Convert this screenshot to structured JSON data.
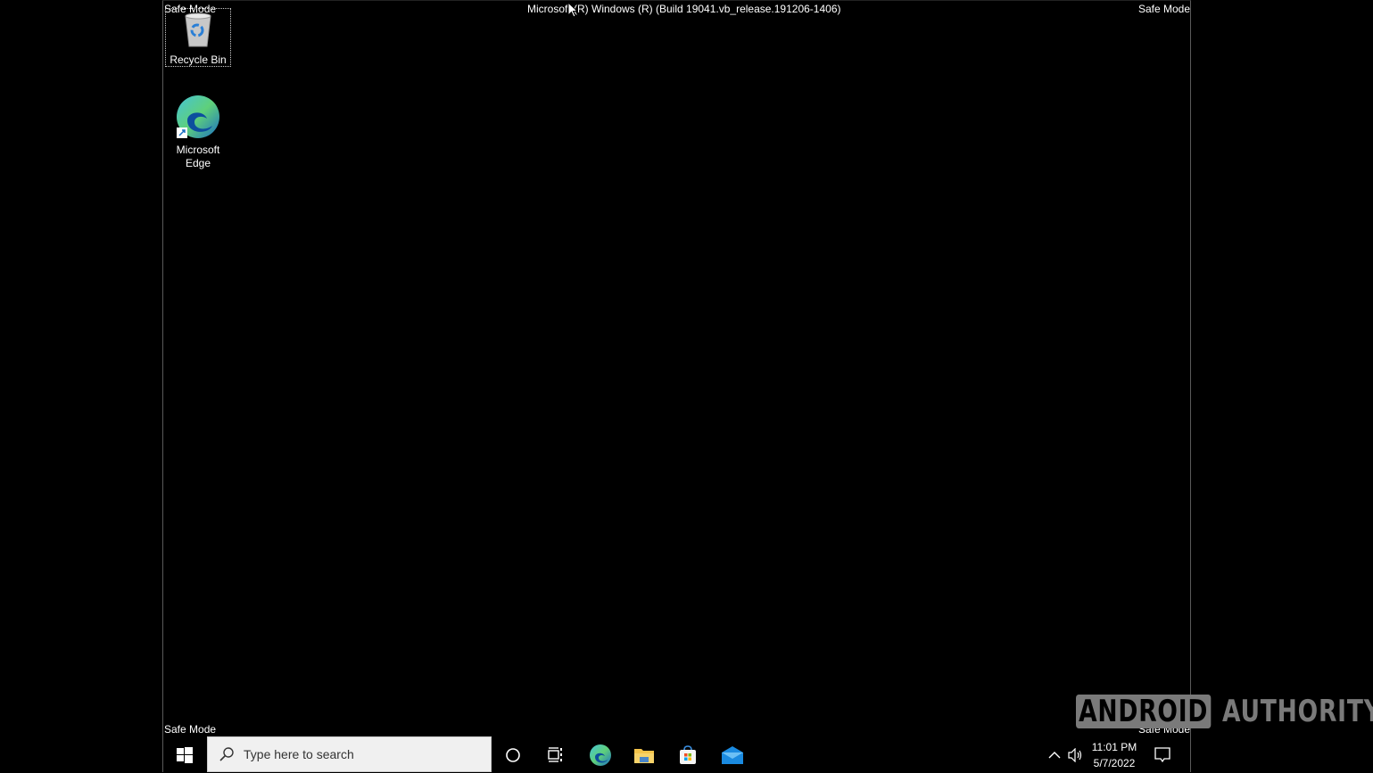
{
  "safe_mode_label": "Safe Mode",
  "build_string": "Microsoft (R) Windows (R) (Build 19041.vb_release.191206-1406)",
  "desktop_icons": [
    {
      "label": "Recycle Bin",
      "icon": "recycle-bin-icon"
    },
    {
      "label": "Microsoft Edge",
      "icon": "edge-icon"
    }
  ],
  "taskbar": {
    "start_icon": "windows-logo-icon",
    "search_placeholder": "Type here to search",
    "pinned": [
      {
        "name": "cortana",
        "icon": "cortana-circle-icon"
      },
      {
        "name": "task-view",
        "icon": "task-view-icon"
      },
      {
        "name": "edge",
        "icon": "edge-icon"
      },
      {
        "name": "file-explorer",
        "icon": "folder-icon"
      },
      {
        "name": "store",
        "icon": "store-bag-icon"
      },
      {
        "name": "mail",
        "icon": "mail-envelope-icon"
      }
    ],
    "tray": {
      "time": "11:01 PM",
      "date": "5/7/2022"
    }
  },
  "watermark": {
    "part1": "ANDROID",
    "part2": "AUTHORITY"
  },
  "colors": {
    "taskbar_bg": "#000000",
    "search_bg": "#f0f0f0",
    "edge_blue": "#1a7fd4",
    "edge_green": "#5fd07a",
    "folder_yellow": "#f4c44a",
    "mail_blue": "#1a8ae0"
  }
}
